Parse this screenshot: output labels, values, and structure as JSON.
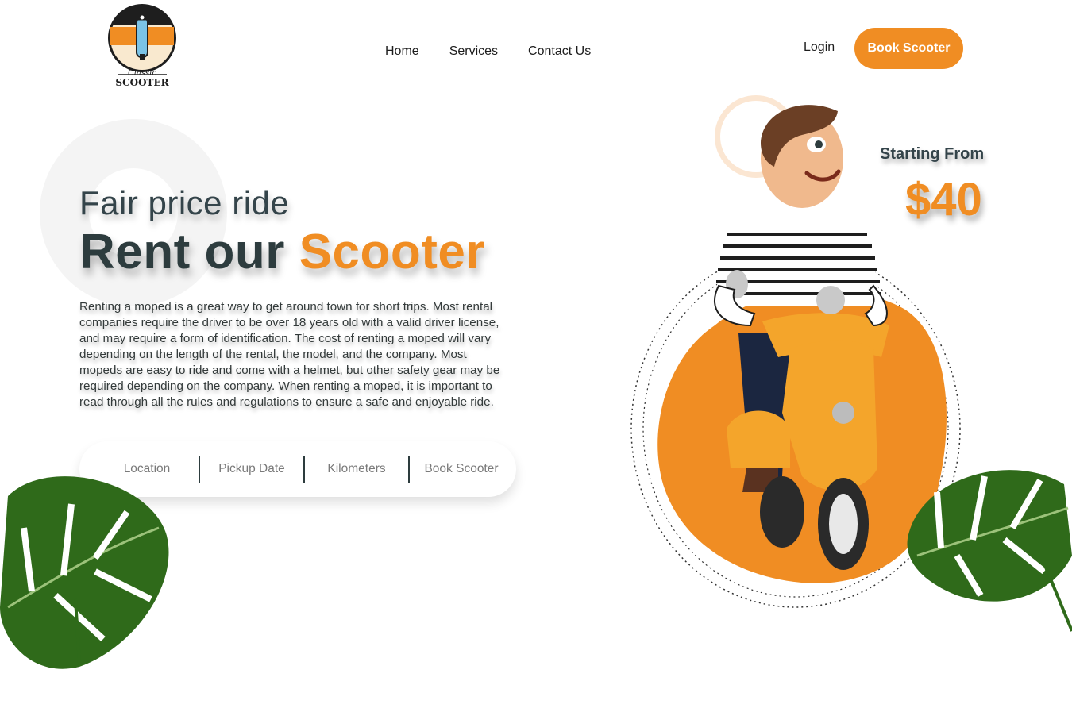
{
  "header": {
    "logo": {
      "line1": "Classic",
      "line2": "SCOOTER"
    },
    "nav": [
      {
        "label": "Home"
      },
      {
        "label": "Services"
      },
      {
        "label": "Contact Us"
      }
    ],
    "login_label": "Login",
    "book_label": "Book Scooter"
  },
  "hero": {
    "subtitle": "Fair price ride",
    "title_main": "Rent our",
    "title_accent": "Scooter",
    "description": "Renting a moped is a great way to get around town for short trips. Most rental companies require the driver to be over 18 years old with a valid driver license, and may require a form of identification. The cost of renting a moped will vary depending on the length of the rental, the model, and the company. Most mopeds are easy to ride and come with a helmet, but other safety gear may be required depending on the company. When renting a moped, it is important to read through all the rules and regulations to ensure a safe and enjoyable ride."
  },
  "search": {
    "fields": [
      {
        "label": "Location"
      },
      {
        "label": "Pickup Date"
      },
      {
        "label": "Kilometers"
      },
      {
        "label": "Book Scooter"
      }
    ]
  },
  "pricing": {
    "starting_label": "Starting From",
    "price": "$40"
  },
  "colors": {
    "accent": "#f08d23",
    "dark_text": "#2d3c3e",
    "leaf_green": "#2f6a1a"
  },
  "icons": [
    "logo-scooter-icon",
    "man-on-scooter-illustration",
    "monstera-leaf-icon"
  ]
}
